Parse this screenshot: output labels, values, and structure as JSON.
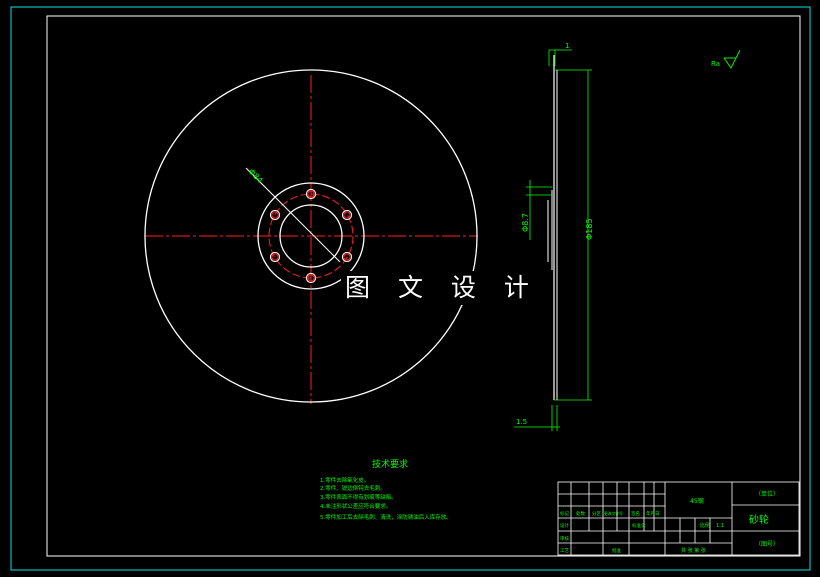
{
  "drawing": {
    "watermark": "图 文 设 计",
    "roughness_label": "Ra",
    "dimensions": {
      "bolt_circle_dia": "Φ84",
      "hub_dia": "Φ8.7",
      "outer_dia": "Φ185",
      "thickness_top": "1",
      "thickness_bottom": "1.5"
    },
    "tech_requirements": {
      "title": "技术要求",
      "items": [
        "1.零件去除氧化皮。",
        "2.零件、锐边倒钝去毛刺。",
        "3.零件表面不得有划痕等缺陷。",
        "4.未注形状公差应符合要求。",
        "5.零件加工后去除毛刺、清洗，涂防锈油后入库存放。"
      ]
    },
    "title_block": {
      "material": "45钢",
      "part_name": "砂轮",
      "company": "（单位）",
      "drawing_no": "（图号）",
      "ratio_label": "比例",
      "ratio_value": "1:1",
      "sheet_label": "共 张 第 张",
      "row_labels": [
        "标记",
        "处数",
        "分区",
        "更改文件号",
        "签名",
        "年月日"
      ],
      "designer": "设计",
      "reviewer": "审核",
      "craft": "工艺",
      "approve": "批准",
      "standard": "标准化"
    }
  },
  "colors": {
    "background": "#000000",
    "border": "#00ffff",
    "geometry": "#ffffff",
    "centerline": "#ff0000",
    "dimension": "#00ff00",
    "bolt_holes": "#ff0000"
  }
}
